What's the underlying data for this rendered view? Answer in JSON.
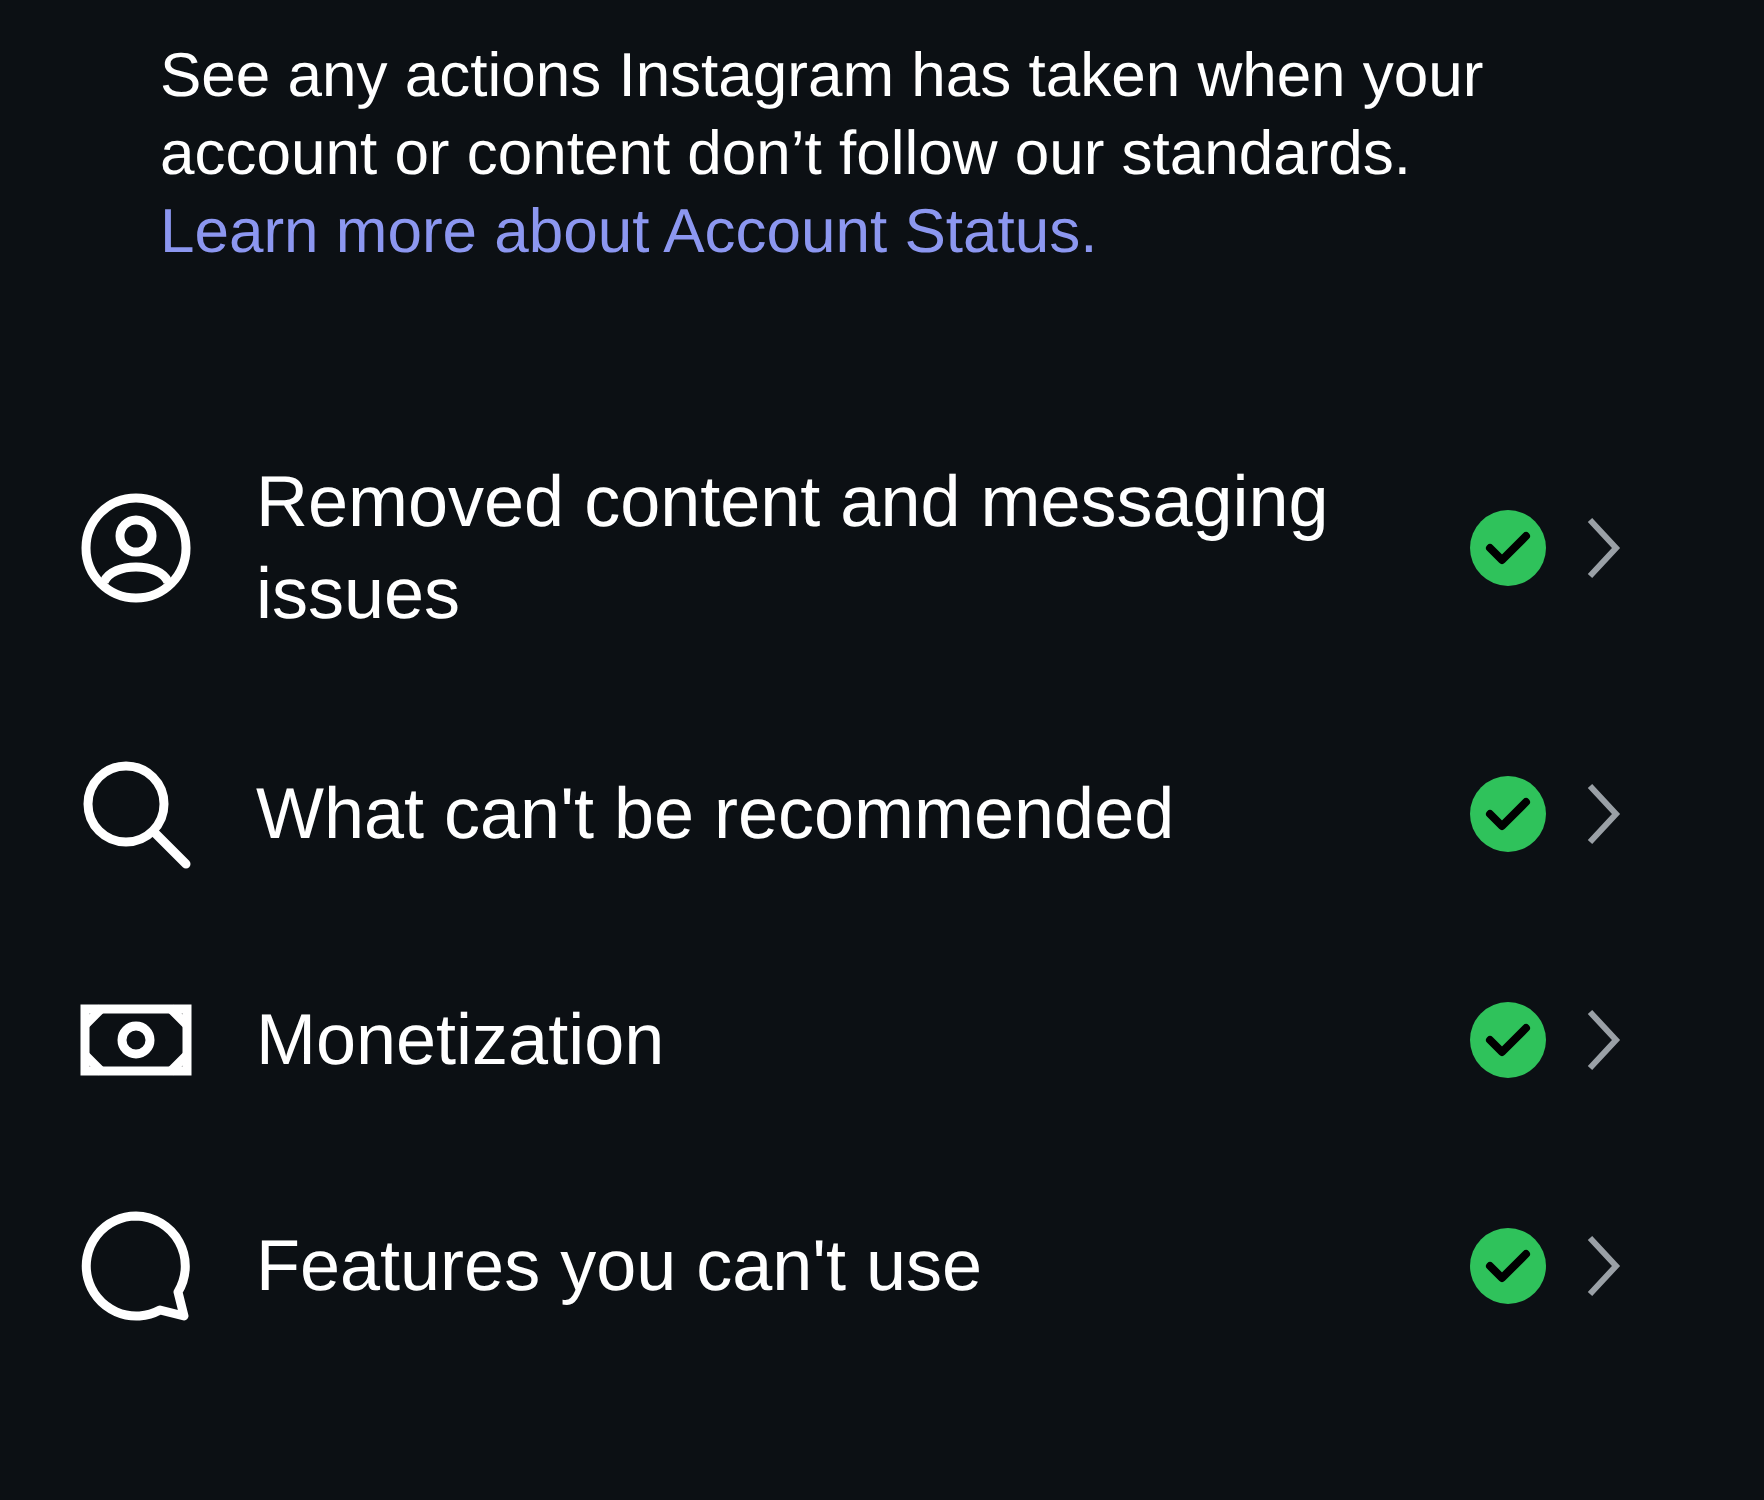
{
  "intro": {
    "text": "See any actions Instagram has taken when your account or content don’t follow our standards.",
    "link": "Learn more about Account Status."
  },
  "items": [
    {
      "label": "Removed content and messaging issues",
      "ok": true
    },
    {
      "label": "What can't be recommended",
      "ok": true
    },
    {
      "label": "Monetization",
      "ok": true
    },
    {
      "label": "Features you can't use",
      "ok": true
    }
  ]
}
